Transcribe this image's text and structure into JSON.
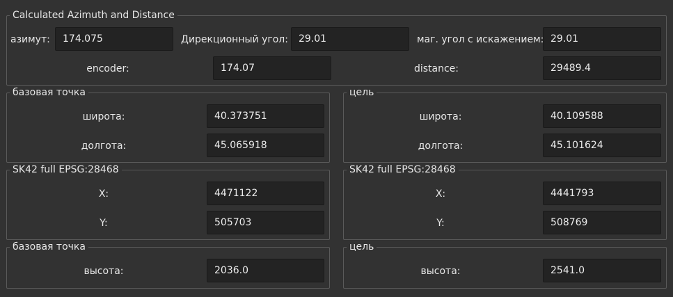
{
  "calc": {
    "title": "Calculated Azimuth and Distance",
    "azimuth_label": "азимут:",
    "azimuth_value": "174.075",
    "directional_angle_label": "Дирекционный угол:",
    "directional_angle_value": "29.01",
    "mag_angle_label": "маг. угол с искажением:",
    "mag_angle_value": "29.01",
    "encoder_label": "encoder:",
    "encoder_value": "174.07",
    "distance_label": "distance:",
    "distance_value": "29489.4"
  },
  "base_point": {
    "title": "базовая точка",
    "lat_label": "широта:",
    "lat_value": "40.373751",
    "lon_label": "долгота:",
    "lon_value": "45.065918"
  },
  "target": {
    "title": "цель",
    "lat_label": "широта:",
    "lat_value": "40.109588",
    "lon_label": "долгота:",
    "lon_value": "45.101624"
  },
  "base_sk42": {
    "title": "SK42 full EPSG:28468",
    "x_label": "X:",
    "x_value": "4471122",
    "y_label": "Y:",
    "y_value": "505703"
  },
  "target_sk42": {
    "title": "SK42 full EPSG:28468",
    "x_label": "X:",
    "x_value": "4441793",
    "y_label": "Y:",
    "y_value": "508769"
  },
  "base_alt": {
    "title": "базовая точка",
    "alt_label": "высота:",
    "alt_value": "2036.0"
  },
  "target_alt": {
    "title": "цель",
    "alt_label": "высота:",
    "alt_value": "2541.0"
  }
}
